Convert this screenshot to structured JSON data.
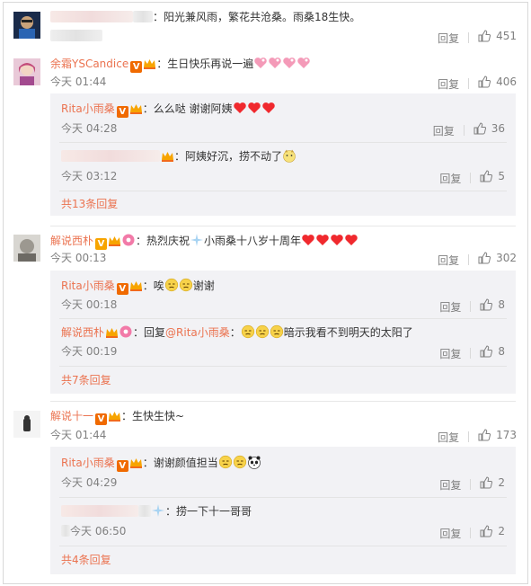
{
  "actions": {
    "reply_label": "回复"
  },
  "comments": [
    {
      "username": "",
      "text": "：阳光兼风雨，繁花共沧桑。雨桑18生快。",
      "time": "",
      "likes": "451"
    },
    {
      "username": "余霜YSCandice",
      "text": "：生日快乐再说一遍",
      "time": "今天 01:44",
      "likes": "406",
      "replies": [
        {
          "username": "Rita小雨桑",
          "text": "：么么哒 谢谢阿姨",
          "time": "今天 04:28",
          "likes": "36"
        },
        {
          "username": "",
          "text": "：阿姨好沉，捞不动了",
          "time": "今天 03:12",
          "likes": "5"
        }
      ],
      "more": "共13条回复"
    },
    {
      "username": "解说西朴",
      "text": "：热烈庆祝",
      "text2": "小雨桑十八岁十周年",
      "time": "今天 00:13",
      "likes": "302",
      "replies": [
        {
          "username": "Rita小雨桑",
          "text": "：唉",
          "text2": "谢谢",
          "time": "今天 00:18",
          "likes": "8"
        },
        {
          "username": "解说西朴",
          "text": "：回复",
          "mention": "@Rita小雨桑",
          "text2": "：",
          "text3": "暗示我看不到明天的太阳了",
          "time": "今天 00:19",
          "likes": "8"
        }
      ],
      "more": "共7条回复"
    },
    {
      "username": "解说十一",
      "text": "：生快生快~",
      "time": "今天 01:44",
      "likes": "173",
      "replies": [
        {
          "username": "Rita小雨桑",
          "text": "：谢谢颜值担当",
          "time": "今天 04:29",
          "likes": "2"
        },
        {
          "username": "",
          "text": "：捞一下十一哥哥",
          "time": "今天 06:50",
          "likes": "2"
        }
      ],
      "more": "共4条回复"
    }
  ],
  "colors": {
    "accent": "#eb7350",
    "muted": "#808080",
    "sub_bg": "#f2f2f5",
    "heart": "#f0292e"
  },
  "icons": {
    "like": "thumbs-up-icon",
    "verified": "orange-v-badge",
    "fan": "crown-badge"
  }
}
